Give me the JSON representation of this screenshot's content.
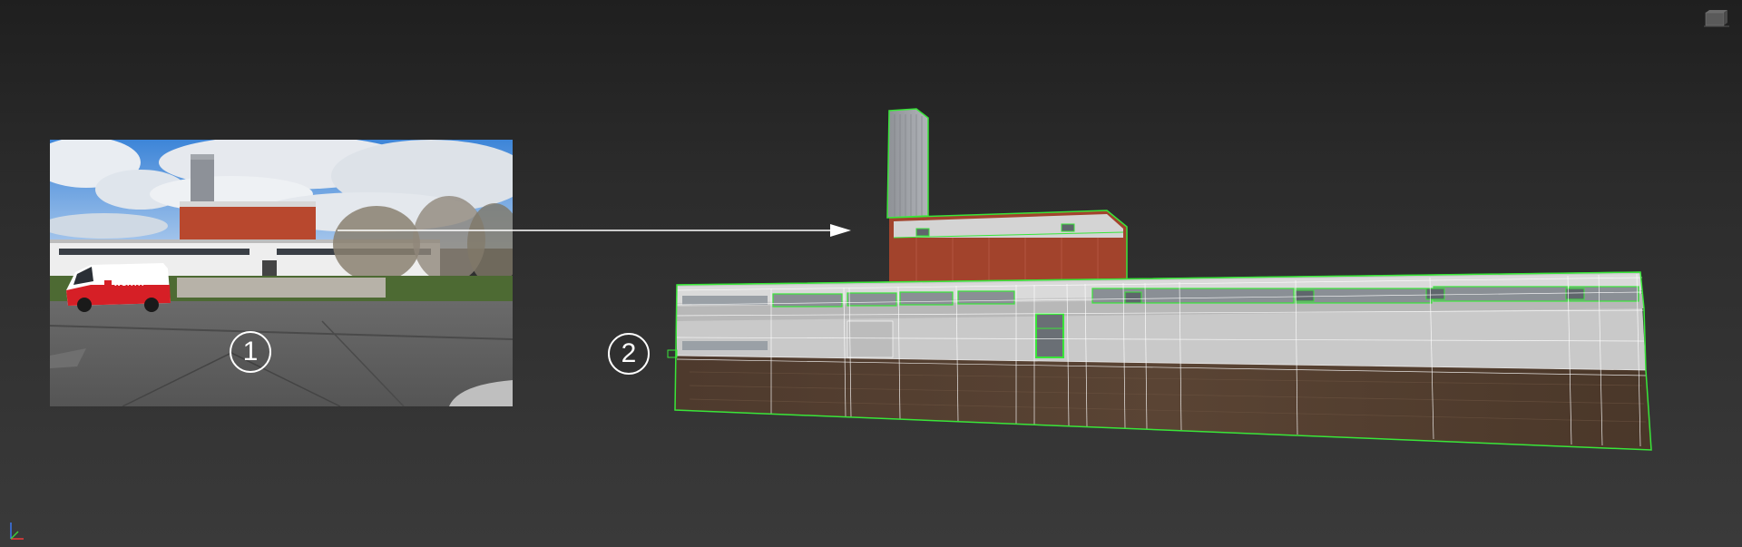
{
  "viewport": {
    "background_top": "#1f1f1f",
    "background_bottom": "#3a3a3a"
  },
  "photo": {
    "van_brand": "WÜRTH",
    "van_color": "#d61f26"
  },
  "markers": {
    "marker_1": "1",
    "marker_2": "2"
  },
  "model": {
    "outline_color": "#39e639",
    "wire_color": "#ffffff"
  },
  "icons": {
    "view_cube": "view-cube-icon",
    "axis_gizmo": "axis-gizmo-icon",
    "arrow": "arrow-right-icon"
  }
}
